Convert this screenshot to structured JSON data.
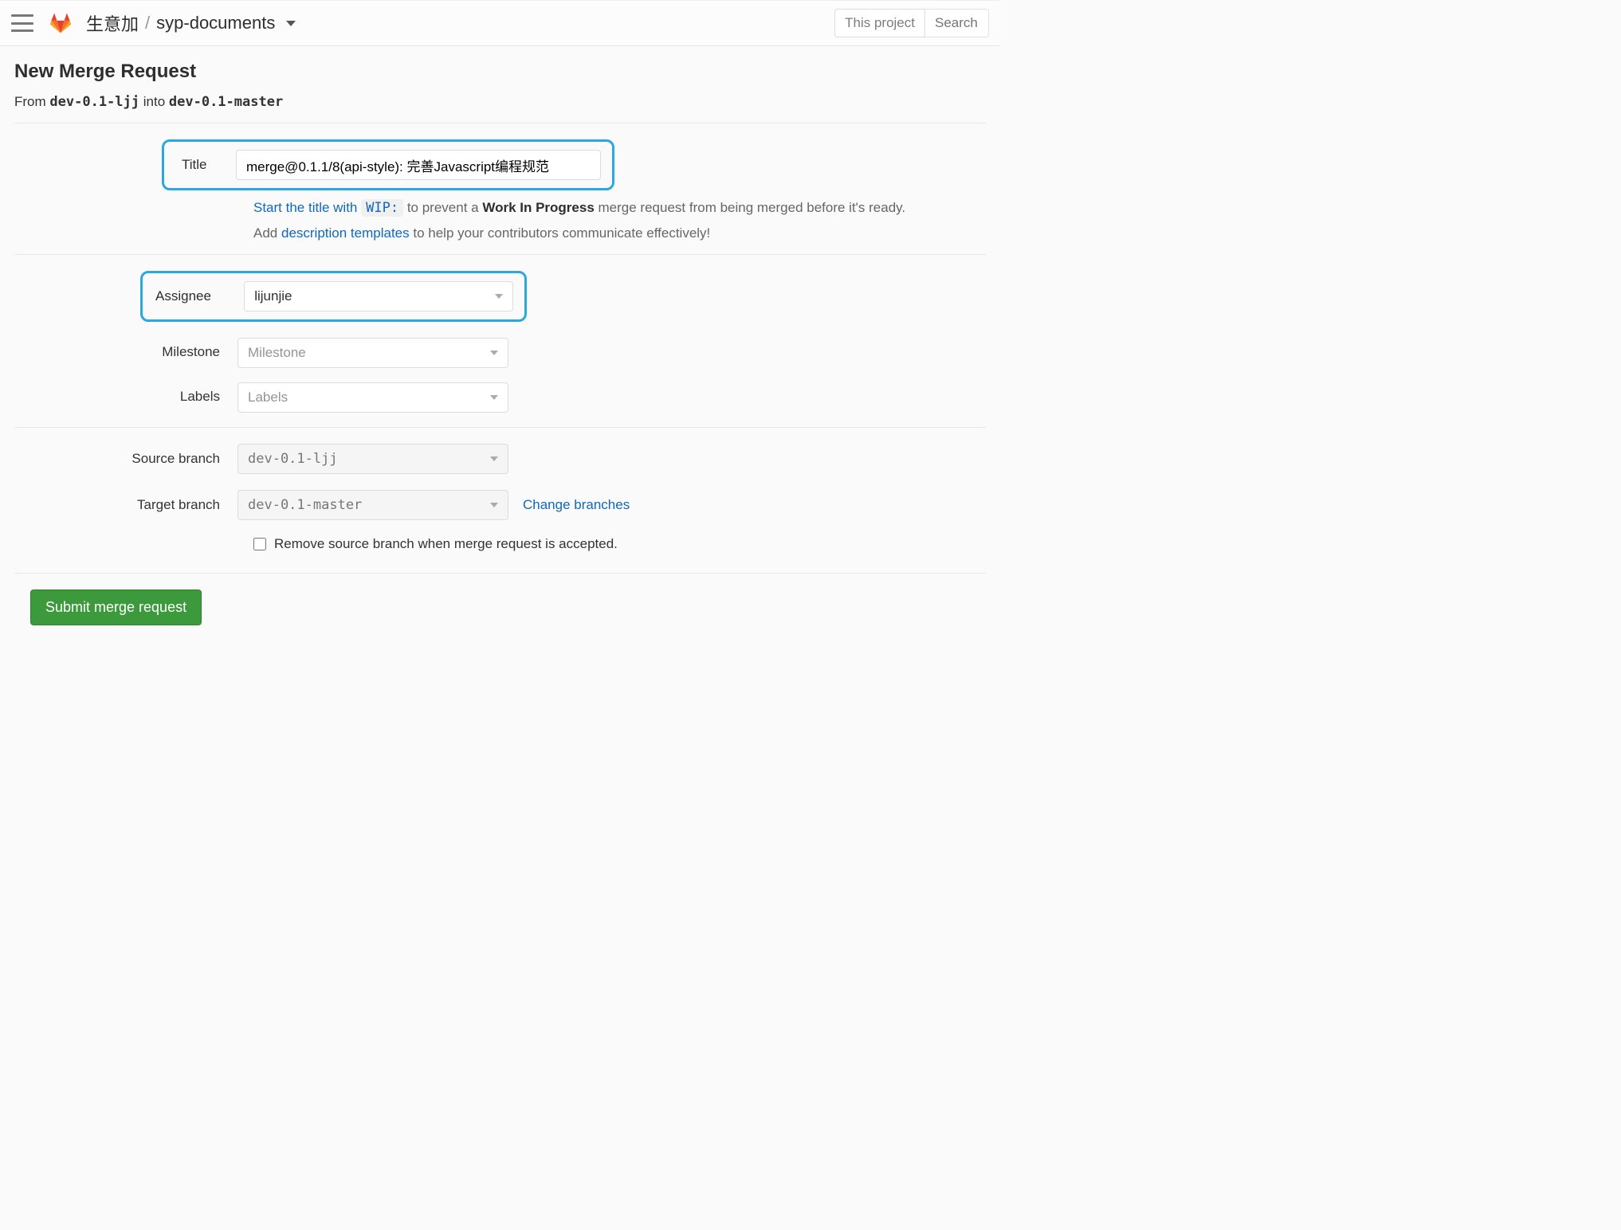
{
  "topbar": {
    "project_group": "生意加",
    "separator": "/",
    "project_name": "syp-documents",
    "scope_button": "This project",
    "search_placeholder": "Search"
  },
  "page": {
    "title": "New Merge Request",
    "from_label": "From",
    "into_label": "into",
    "source_branch": "dev-0.1-ljj",
    "target_branch": "dev-0.1-master"
  },
  "form": {
    "title_label": "Title",
    "title_value": "merge@0.1.1/8(api-style): 完善Javascript编程规范",
    "wip_help_prefix": "Start the title with",
    "wip_code": "WIP:",
    "wip_help_mid": "to prevent a",
    "wip_help_bold": "Work In Progress",
    "wip_help_suffix": "merge request from being merged before it's ready.",
    "tpl_help_prefix": "Add",
    "tpl_link_text": "description templates",
    "tpl_help_suffix": "to help your contributors communicate effectively!",
    "assignee_label": "Assignee",
    "assignee_value": "lijunjie",
    "milestone_label": "Milestone",
    "milestone_placeholder": "Milestone",
    "labels_label": "Labels",
    "labels_placeholder": "Labels",
    "source_branch_label": "Source branch",
    "source_branch_value": "dev-0.1-ljj",
    "target_branch_label": "Target branch",
    "target_branch_value": "dev-0.1-master",
    "change_branches_link": "Change branches",
    "remove_source_checkbox": "Remove source branch when merge request is accepted.",
    "submit_button": "Submit merge request"
  }
}
